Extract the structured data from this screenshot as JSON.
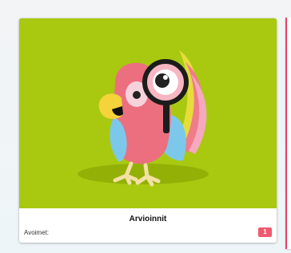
{
  "card": {
    "title": "Arvioinnit",
    "open_label": "Avoimet:",
    "open_count": "1",
    "image_icon": "parrot-with-magnifier-illustration"
  },
  "colors": {
    "image_background": "#a9c910",
    "badge": "#ef5a6f",
    "neighbor_card_accent": "#f03c66"
  }
}
